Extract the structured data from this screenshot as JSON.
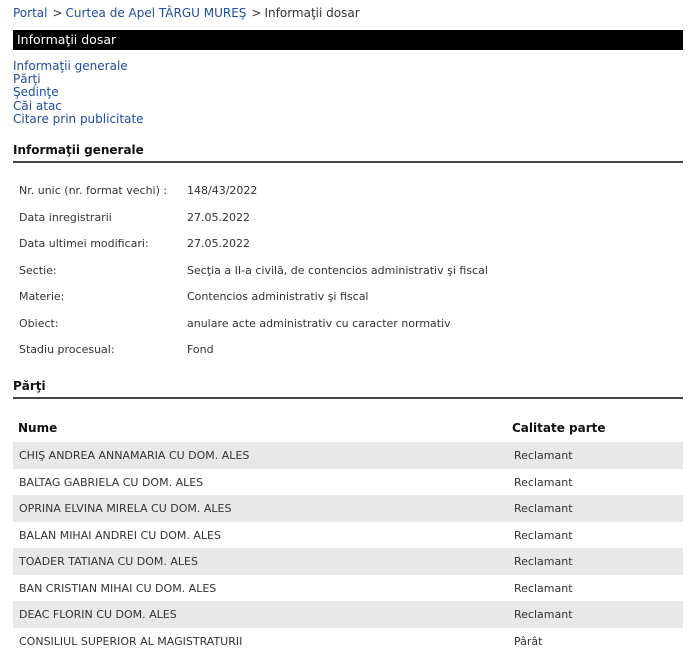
{
  "breadcrumb": {
    "portal": "Portal",
    "sep1": ">",
    "court": "Curtea de Apel TÂRGU MUREŞ",
    "sep2": ">",
    "current": "Informaţii dosar"
  },
  "title_bar": "Informaţii dosar",
  "nav_links": [
    "Informaţii generale",
    "Părţi",
    "Şedinţe",
    "Căi atac",
    "Citare prin publicitate"
  ],
  "general": {
    "section_title": "Informaţii generale",
    "rows": [
      {
        "label": "Nr. unic (nr. format vechi) :",
        "value": "148/43/2022"
      },
      {
        "label": "Data inregistrarii",
        "value": "27.05.2022"
      },
      {
        "label": "Data ultimei modificari:",
        "value": "27.05.2022"
      },
      {
        "label": "Sectie:",
        "value": "Secţia a II-a civilă, de contencios administrativ şi fiscal"
      },
      {
        "label": "Materie:",
        "value": "Contencios administrativ şi fiscal"
      },
      {
        "label": "Obiect:",
        "value": "anulare acte administrativ cu caracter normativ"
      },
      {
        "label": "Stadiu procesual:",
        "value": "Fond"
      }
    ]
  },
  "parties": {
    "section_title": "Părţi",
    "col_name": "Nume",
    "col_role": "Calitate parte",
    "rows": [
      {
        "name": "CHIŞ ANDREA ANNAMARIA CU DOM. ALES",
        "role": "Reclamant"
      },
      {
        "name": "BALTAG GABRIELA CU DOM. ALES",
        "role": "Reclamant"
      },
      {
        "name": "OPRINA ELVINA MIRELA CU DOM. ALES",
        "role": "Reclamant"
      },
      {
        "name": "BALAN MIHAI ANDREI CU DOM. ALES",
        "role": "Reclamant"
      },
      {
        "name": "TOADER TATIANA CU DOM. ALES",
        "role": "Reclamant"
      },
      {
        "name": "BAN CRISTIAN MIHAI CU DOM. ALES",
        "role": "Reclamant"
      },
      {
        "name": "DEAC FLORIN CU DOM. ALES",
        "role": "Reclamant"
      },
      {
        "name": "CONSILIUL SUPERIOR AL MAGISTRATURII",
        "role": "Pârât"
      }
    ]
  },
  "colors": {
    "link": "#1f4e9c",
    "title_bar_bg": "#000000",
    "row_alt_bg": "#e8e8e8"
  }
}
